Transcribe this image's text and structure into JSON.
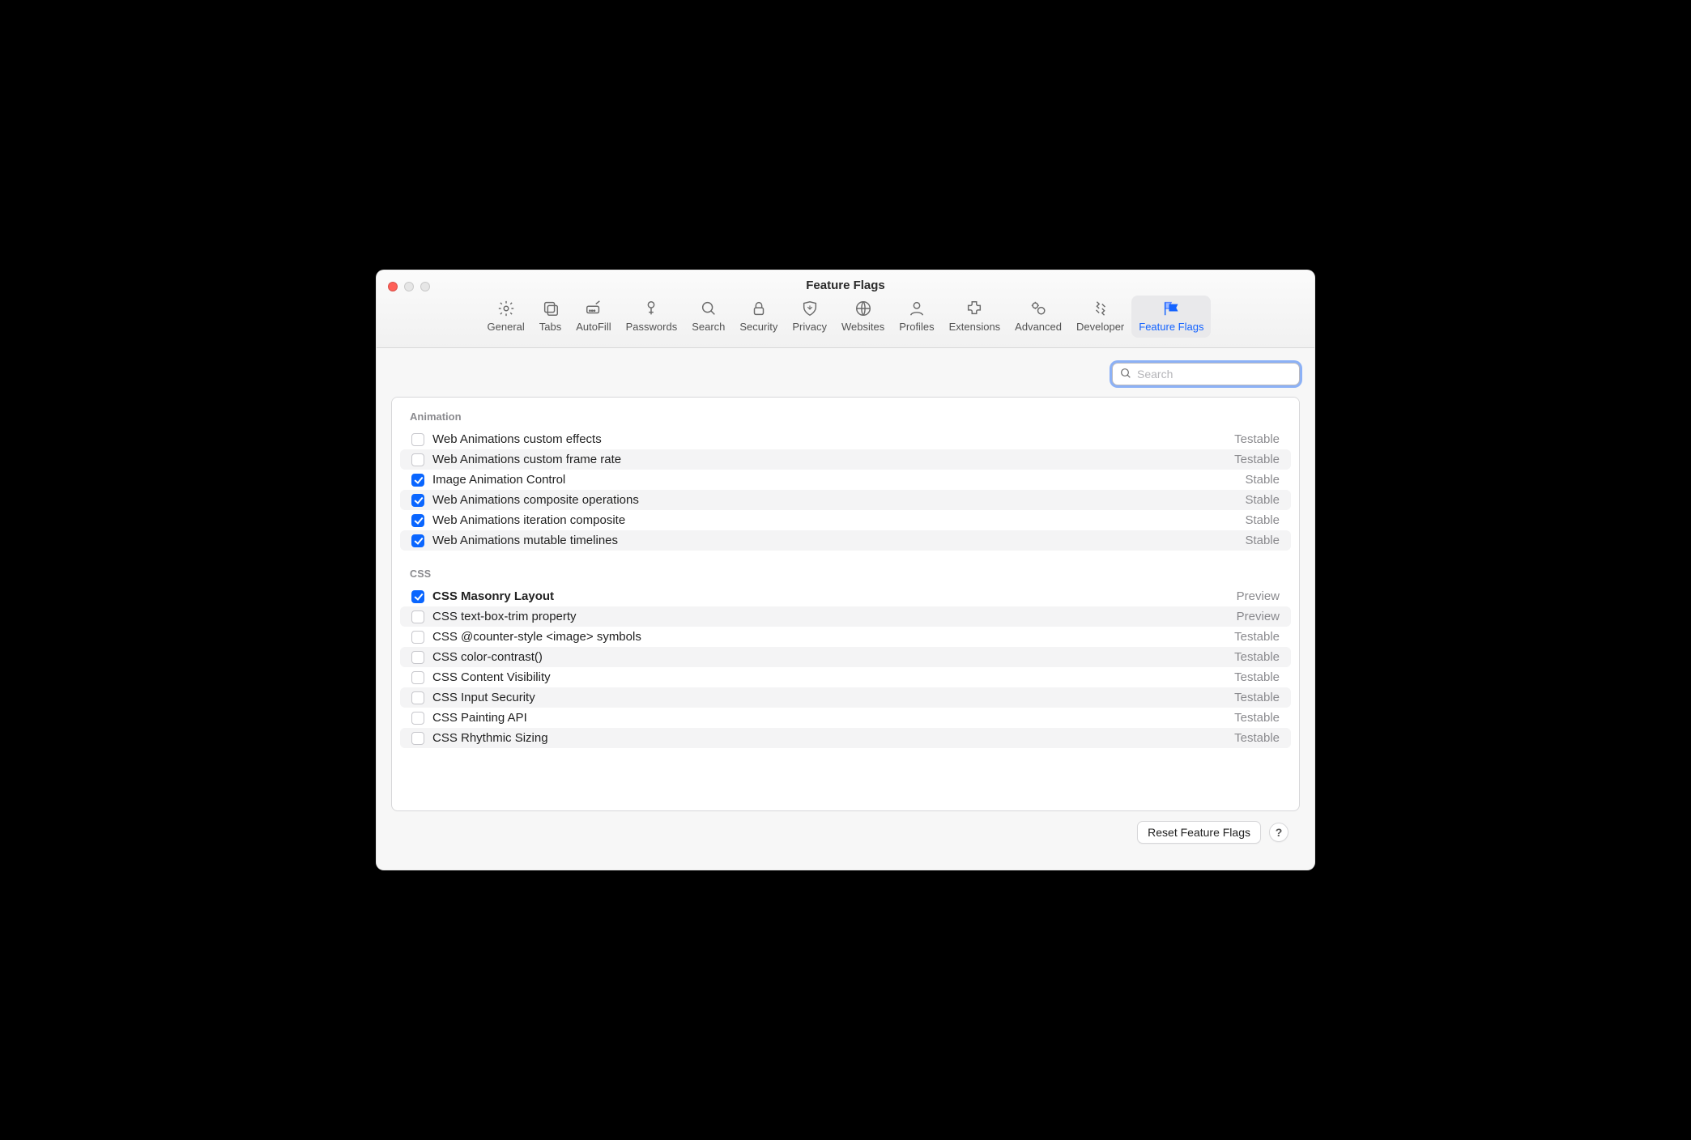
{
  "window": {
    "title": "Feature Flags"
  },
  "toolbar": {
    "items": [
      {
        "id": "general",
        "label": "General"
      },
      {
        "id": "tabs",
        "label": "Tabs"
      },
      {
        "id": "autofill",
        "label": "AutoFill"
      },
      {
        "id": "passwords",
        "label": "Passwords"
      },
      {
        "id": "search",
        "label": "Search"
      },
      {
        "id": "security",
        "label": "Security"
      },
      {
        "id": "privacy",
        "label": "Privacy"
      },
      {
        "id": "websites",
        "label": "Websites"
      },
      {
        "id": "profiles",
        "label": "Profiles"
      },
      {
        "id": "extensions",
        "label": "Extensions"
      },
      {
        "id": "advanced",
        "label": "Advanced"
      },
      {
        "id": "developer",
        "label": "Developer"
      },
      {
        "id": "feature-flags",
        "label": "Feature Flags"
      }
    ],
    "active": "feature-flags"
  },
  "search": {
    "placeholder": "Search",
    "value": ""
  },
  "groups": [
    {
      "title": "Animation",
      "rows": [
        {
          "checked": false,
          "label": "Web Animations custom effects",
          "status": "Testable"
        },
        {
          "checked": false,
          "label": "Web Animations custom frame rate",
          "status": "Testable"
        },
        {
          "checked": true,
          "label": "Image Animation Control",
          "status": "Stable"
        },
        {
          "checked": true,
          "label": "Web Animations composite operations",
          "status": "Stable"
        },
        {
          "checked": true,
          "label": "Web Animations iteration composite",
          "status": "Stable"
        },
        {
          "checked": true,
          "label": "Web Animations mutable timelines",
          "status": "Stable"
        }
      ]
    },
    {
      "title": "CSS",
      "rows": [
        {
          "checked": true,
          "label": "CSS Masonry Layout",
          "status": "Preview",
          "bold": true
        },
        {
          "checked": false,
          "label": "CSS text-box-trim property",
          "status": "Preview"
        },
        {
          "checked": false,
          "label": "CSS @counter-style <image> symbols",
          "status": "Testable"
        },
        {
          "checked": false,
          "label": "CSS color-contrast()",
          "status": "Testable"
        },
        {
          "checked": false,
          "label": "CSS Content Visibility",
          "status": "Testable"
        },
        {
          "checked": false,
          "label": "CSS Input Security",
          "status": "Testable"
        },
        {
          "checked": false,
          "label": "CSS Painting API",
          "status": "Testable"
        },
        {
          "checked": false,
          "label": "CSS Rhythmic Sizing",
          "status": "Testable"
        }
      ]
    }
  ],
  "footer": {
    "reset": "Reset Feature Flags",
    "help": "?"
  }
}
